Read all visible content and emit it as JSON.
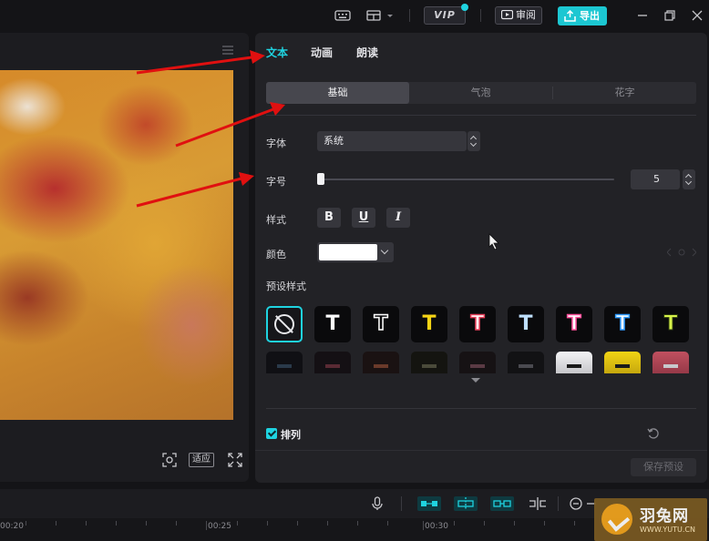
{
  "topbar": {
    "vip_label": "VIP",
    "review_label": "审阅",
    "export_label": "导出"
  },
  "preview": {
    "fit_label": "适应"
  },
  "panel": {
    "tabs": [
      {
        "label": "文本",
        "active": true
      },
      {
        "label": "动画",
        "active": false
      },
      {
        "label": "朗读",
        "active": false
      }
    ],
    "subtabs": [
      {
        "label": "基础",
        "active": true
      },
      {
        "label": "气泡",
        "active": false
      },
      {
        "label": "花字",
        "active": false
      }
    ],
    "font_label": "字体",
    "font_value": "系统",
    "size_label": "字号",
    "size_value": "5",
    "size_fraction": 0.0,
    "style_label": "样式",
    "style_buttons": [
      "B",
      "U",
      "I"
    ],
    "color_label": "颜色",
    "color_value": "#ffffff",
    "presets_label": "预设样式",
    "presets_row1": [
      {
        "glyph": "",
        "kind": "none"
      },
      {
        "glyph": "T",
        "color": "#ffffff",
        "stroke": "#000000"
      },
      {
        "glyph": "T",
        "color": "#0a0a0c",
        "stroke": "#ffffff"
      },
      {
        "glyph": "T",
        "color": "#f5d415",
        "stroke": "#000000"
      },
      {
        "glyph": "T",
        "color": "#ffffff",
        "stroke": "#e8405a"
      },
      {
        "glyph": "T",
        "color": "#bfe0ff",
        "stroke": "#000000"
      },
      {
        "glyph": "T",
        "color": "#ffffff",
        "stroke": "#ff4f9a"
      },
      {
        "glyph": "T",
        "color": "#ffffff",
        "stroke": "#2f9bff"
      },
      {
        "glyph": "T",
        "color": "#d7f24a",
        "stroke": "#2c3a10"
      }
    ],
    "presets_row2_colors": [
      "#101014",
      "#141014",
      "#1a1212",
      "#141410",
      "#161214",
      "#121214",
      "#d8d8dc",
      "#e4c414",
      "#b8485a"
    ],
    "arrange_label": "排列",
    "arrange_checked": true,
    "save_preset_label": "保存预设"
  },
  "timeline": {
    "time_labels": [
      "00:20",
      "00:25",
      "00:30"
    ]
  },
  "watermark": {
    "title": "羽兔网",
    "url": "WWW.YUTU.CN"
  },
  "colors": {
    "accent": "#1fd3e0",
    "arrow": "#e01010"
  }
}
